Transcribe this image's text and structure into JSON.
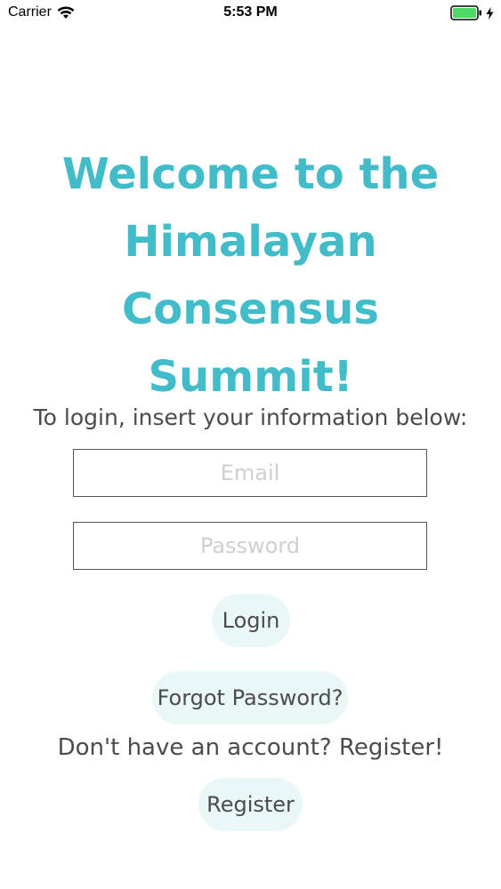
{
  "status_bar": {
    "carrier": "Carrier",
    "time": "5:53 PM",
    "battery_color": "#4cd964"
  },
  "welcome": {
    "title": "Welcome to the Himalayan Consensus Summit!",
    "color": "#43bcc9"
  },
  "login_form": {
    "instruction": "To login, insert your information below:",
    "email_placeholder": "Email",
    "password_placeholder": "Password",
    "login_label": "Login",
    "forgot_label": "Forgot Password?"
  },
  "register": {
    "prompt": "Don't have an account? Register!",
    "button_label": "Register"
  }
}
